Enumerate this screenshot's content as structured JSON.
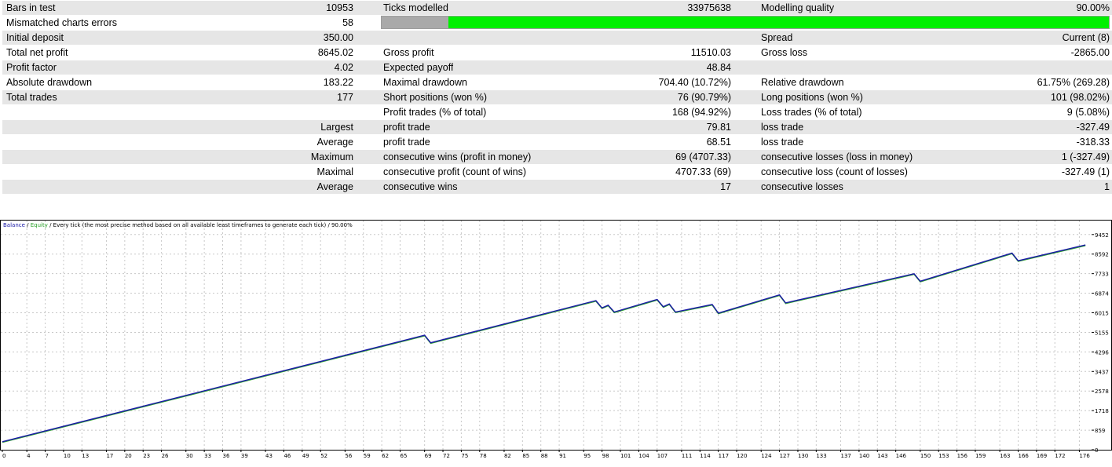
{
  "report": {
    "rows": [
      {
        "l1": "Bars in test",
        "v1": "10953",
        "l2": "Ticks modelled",
        "v2": "33975638",
        "l3": "Modelling quality",
        "v3": "90.00%",
        "shade": true
      },
      {
        "l1": "Mismatched charts errors",
        "v1": "58",
        "l2": "",
        "v2": "",
        "l3": "",
        "v3": "",
        "shade": false
      },
      {
        "l1": "Initial deposit",
        "v1": "350.00",
        "l2": "",
        "v2": "",
        "l3": "Spread",
        "v3": "Current (8)",
        "shade": true
      },
      {
        "l1": "Total net profit",
        "v1": "8645.02",
        "l2": "Gross profit",
        "v2": "11510.03",
        "l3": "Gross loss",
        "v3": "-2865.00",
        "shade": false
      },
      {
        "l1": "Profit factor",
        "v1": "4.02",
        "l2": "Expected payoff",
        "v2": "48.84",
        "l3": "",
        "v3": "",
        "shade": true
      },
      {
        "l1": "Absolute drawdown",
        "v1": "183.22",
        "l2": "Maximal drawdown",
        "v2": "704.40 (10.72%)",
        "l3": "Relative drawdown",
        "v3": "61.75% (269.28)",
        "shade": false
      },
      {
        "l1": "Total trades",
        "v1": "177",
        "l2": "Short positions (won %)",
        "v2": "76 (90.79%)",
        "l3": "Long positions (won %)",
        "v3": "101 (98.02%)",
        "shade": true
      },
      {
        "l1": "",
        "v1": "",
        "l2": "Profit trades (% of total)",
        "v2": "168 (94.92%)",
        "l3": "Loss trades (% of total)",
        "v3": "9 (5.08%)",
        "shade": false
      },
      {
        "l1": "",
        "v1": "Largest",
        "l2": "profit trade",
        "v2": "79.81",
        "l3": "loss trade",
        "v3": "-327.49",
        "shade": true
      },
      {
        "l1": "",
        "v1": "Average",
        "l2": "profit trade",
        "v2": "68.51",
        "l3": "loss trade",
        "v3": "-318.33",
        "shade": false
      },
      {
        "l1": "",
        "v1": "Maximum",
        "l2": "consecutive wins (profit in money)",
        "v2": "69 (4707.33)",
        "l3": "consecutive losses (loss in money)",
        "v3": "1 (-327.49)",
        "shade": true
      },
      {
        "l1": "",
        "v1": "Maximal",
        "l2": "consecutive profit (count of wins)",
        "v2": "4707.33 (69)",
        "l3": "consecutive loss (count of losses)",
        "v3": "-327.49 (1)",
        "shade": false
      },
      {
        "l1": "",
        "v1": "Average",
        "l2": "consecutive wins",
        "v2": "17",
        "l3": "consecutive losses",
        "v3": "1",
        "shade": true
      }
    ],
    "modelling_quality_fraction": 0.9,
    "bar_colors": {
      "filled": "#00f000",
      "unfilled": "#a9a9a9"
    }
  },
  "chart": {
    "legend": {
      "balance": "Balance",
      "sep1": " / ",
      "equity": "Equity",
      "rest": " / Every tick (the most precise method based on all available least timeframes to generate each tick) / 90.00%"
    },
    "colors": {
      "balance": "#1a1aa6",
      "equity": "#2aa02a",
      "grid": "#c8c8c8",
      "frame": "#000000"
    }
  },
  "chart_data": {
    "type": "line",
    "y_ticks": [
      0,
      859,
      1718,
      2578,
      3437,
      4296,
      5155,
      6015,
      6874,
      7733,
      8592,
      9452
    ],
    "x_ticks": [
      0,
      4,
      7,
      10,
      13,
      17,
      20,
      23,
      26,
      30,
      33,
      36,
      39,
      43,
      46,
      49,
      52,
      56,
      59,
      62,
      65,
      69,
      72,
      75,
      78,
      82,
      85,
      88,
      91,
      95,
      98,
      101,
      104,
      107,
      111,
      114,
      117,
      120,
      124,
      127,
      130,
      133,
      137,
      140,
      143,
      146,
      150,
      153,
      156,
      159,
      163,
      166,
      169,
      172,
      176
    ],
    "xlim": [
      0,
      178
    ],
    "ylim": [
      0,
      10100
    ],
    "series": [
      {
        "name": "Balance",
        "x": [
          0,
          69,
          70,
          97,
          98,
          99,
          100,
          107,
          108,
          109,
          110,
          116,
          117,
          127,
          128,
          149,
          150,
          165,
          166,
          177
        ],
        "y": [
          350,
          5030,
          4700,
          6550,
          6230,
          6350,
          6050,
          6600,
          6280,
          6400,
          6050,
          6380,
          6000,
          6800,
          6450,
          7730,
          7400,
          8640,
          8300,
          8995
        ]
      }
    ]
  }
}
